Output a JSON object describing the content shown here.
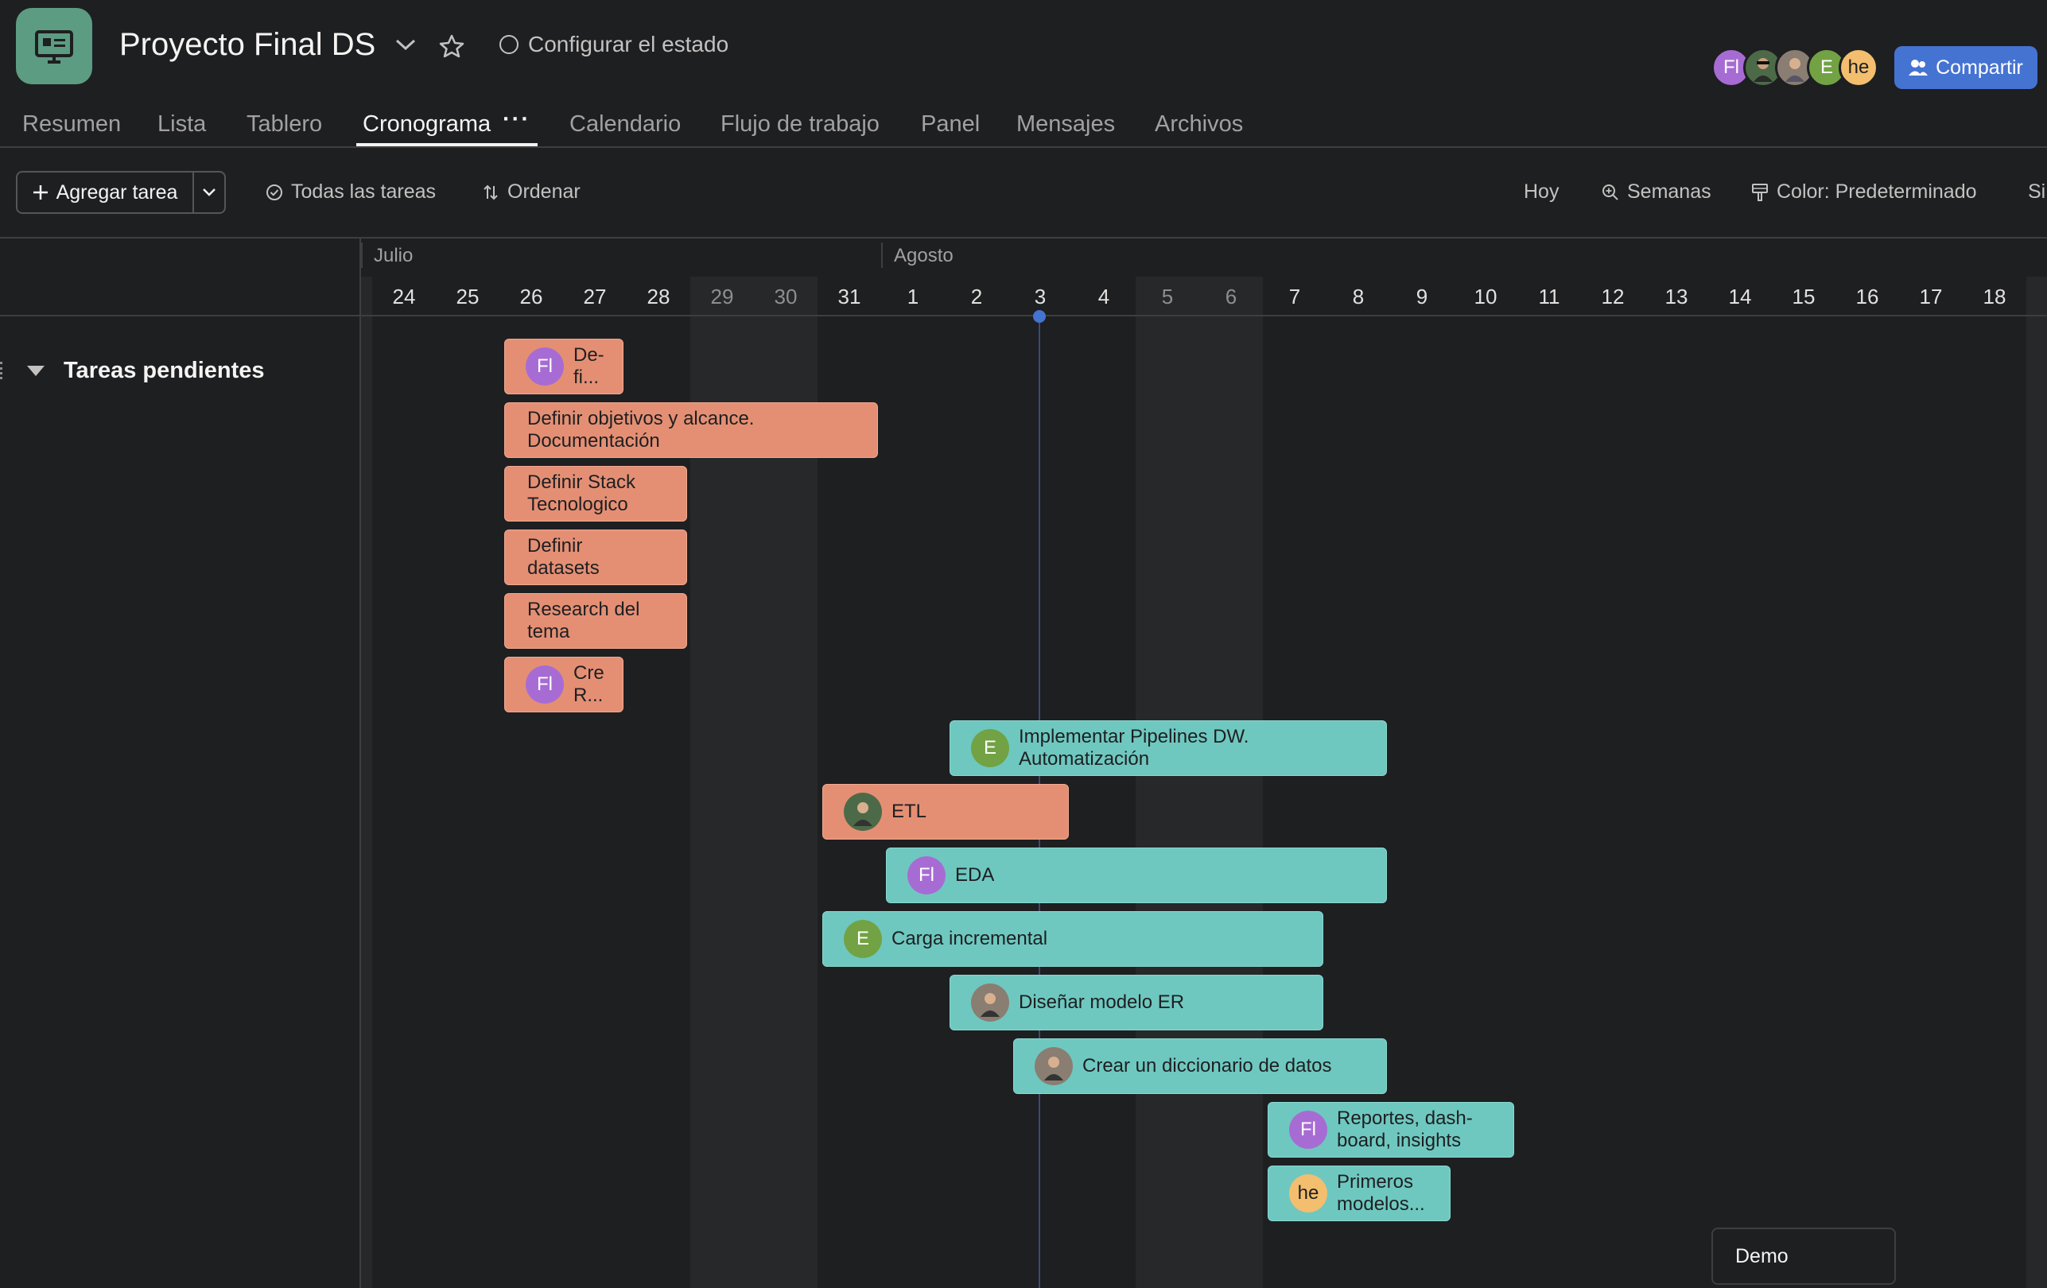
{
  "header": {
    "title": "Proyecto Final DS",
    "status_label": "Configurar el estado",
    "share_label": "Compartir",
    "members": [
      {
        "initials": "Fl",
        "color": "#a76cd3",
        "kind": "initials"
      },
      {
        "initials": "",
        "color": "#4c6a48",
        "kind": "photo"
      },
      {
        "initials": "",
        "color": "#8a7d72",
        "kind": "photo"
      },
      {
        "initials": "E",
        "color": "#72a243",
        "kind": "initials"
      },
      {
        "initials": "he",
        "color": "#f3be6e",
        "kind": "initials"
      }
    ]
  },
  "tabs": [
    {
      "label": "Resumen",
      "active": false
    },
    {
      "label": "Lista",
      "active": false
    },
    {
      "label": "Tablero",
      "active": false
    },
    {
      "label": "Cronograma",
      "active": true
    },
    {
      "label": "Calendario",
      "active": false
    },
    {
      "label": "Flujo de trabajo",
      "active": false
    },
    {
      "label": "Panel",
      "active": false
    },
    {
      "label": "Mensajes",
      "active": false
    },
    {
      "label": "Archivos",
      "active": false
    }
  ],
  "toolbar": {
    "add_task": "Agregar tarea",
    "all_tasks": "Todas las tareas",
    "sort": "Ordenar",
    "today": "Hoy",
    "zoom": "Semanas",
    "color": "Color: Predeterminado",
    "overflow_text": "Si"
  },
  "timeline": {
    "months": [
      {
        "label": "Julio"
      },
      {
        "label": "Agosto"
      }
    ],
    "days": [
      "24",
      "25",
      "26",
      "27",
      "28",
      "29",
      "30",
      "31",
      "1",
      "2",
      "3",
      "4",
      "5",
      "6",
      "7",
      "8",
      "9",
      "10",
      "11",
      "12",
      "13",
      "14",
      "15",
      "16",
      "17",
      "18"
    ],
    "weekend_indices": [
      5,
      6,
      12,
      13
    ],
    "today_index": 10
  },
  "section": {
    "title": "Tareas pendientes"
  },
  "tasks": [
    {
      "label": "De-\nfi...",
      "color": "orange",
      "assignee": "Fl",
      "assignee_color": "#a76cd3"
    },
    {
      "label": "Definir objetivos y alcance.\nDocumentación",
      "color": "orange",
      "assignee": ""
    },
    {
      "label": "Definir Stack\nTecnologico",
      "color": "orange",
      "assignee": ""
    },
    {
      "label": "Definir\ndatasets",
      "color": "orange",
      "assignee": ""
    },
    {
      "label": "Research del\ntema",
      "color": "orange",
      "assignee": ""
    },
    {
      "label": "Cre\nR...",
      "color": "orange",
      "assignee": "Fl",
      "assignee_color": "#a76cd3"
    },
    {
      "label": "Implementar Pipelines DW.\nAutomatización",
      "color": "teal",
      "assignee": "E",
      "assignee_color": "#72a243"
    },
    {
      "label": "ETL",
      "color": "orange",
      "assignee": "photo",
      "assignee_color": "#4c6a48"
    },
    {
      "label": "EDA",
      "color": "teal",
      "assignee": "Fl",
      "assignee_color": "#a76cd3"
    },
    {
      "label": "Carga incremental",
      "color": "teal",
      "assignee": "E",
      "assignee_color": "#72a243"
    },
    {
      "label": "Diseñar modelo ER",
      "color": "teal",
      "assignee": "photo",
      "assignee_color": "#8a7d72"
    },
    {
      "label": "Crear un diccionario de datos",
      "color": "teal",
      "assignee": "photo",
      "assignee_color": "#8a7d72"
    },
    {
      "label": "Reportes, dash-\nboard, insights",
      "color": "teal",
      "assignee": "Fl",
      "assignee_color": "#a76cd3"
    },
    {
      "label": "Primeros\nmodelos...",
      "color": "teal",
      "assignee": "he",
      "assignee_color": "#f3be6e"
    }
  ],
  "milestone": {
    "label": "Demo"
  }
}
